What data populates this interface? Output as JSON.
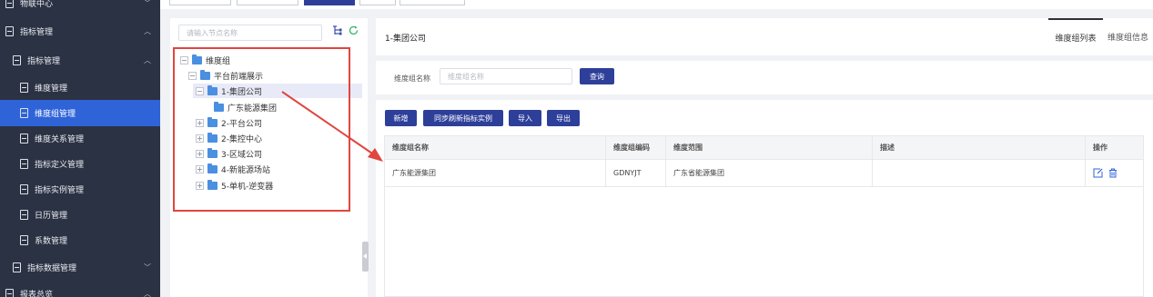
{
  "sidebar": {
    "items": [
      {
        "label": "物联中心",
        "chevron": "﹀"
      },
      {
        "label": "指标管理",
        "chevron": "︿"
      },
      {
        "label": "指标管理",
        "chevron": "︿"
      },
      {
        "label": "维度管理",
        "chevron": ""
      },
      {
        "label": "维度组管理",
        "chevron": ""
      },
      {
        "label": "维度关系管理",
        "chevron": ""
      },
      {
        "label": "指标定义管理",
        "chevron": ""
      },
      {
        "label": "指标实例管理",
        "chevron": ""
      },
      {
        "label": "日历管理",
        "chevron": ""
      },
      {
        "label": "系数管理",
        "chevron": ""
      },
      {
        "label": "指标数据管理",
        "chevron": "﹀"
      },
      {
        "label": "报表总览",
        "chevron": "︿"
      }
    ]
  },
  "tree": {
    "search_placeholder": "请输入节点名称",
    "nodes": [
      {
        "label": "维度组"
      },
      {
        "label": "平台前端展示"
      },
      {
        "label": "1-集团公司"
      },
      {
        "label": "广东能源集团"
      },
      {
        "label": "2-平台公司"
      },
      {
        "label": "2-集控中心"
      },
      {
        "label": "3-区域公司"
      },
      {
        "label": "4-新能源场站"
      },
      {
        "label": "5-单机-逆变器"
      }
    ]
  },
  "header": {
    "title": "1-集团公司",
    "tabs": [
      {
        "label": "维度组列表"
      },
      {
        "label": "维度组信息"
      }
    ]
  },
  "query": {
    "label": "维度组名称",
    "placeholder": "维度组名称",
    "button": "查询"
  },
  "toolbar": {
    "add": "新增",
    "sync": "同步刷新指标实例",
    "import": "导入",
    "export": "导出"
  },
  "table": {
    "columns": [
      "维度组名称",
      "维度组编码",
      "维度范围",
      "描述",
      "操作"
    ],
    "rows": [
      {
        "name": "广东能源集团",
        "code": "GDNYJT",
        "scope": "广东省能源集团",
        "desc": ""
      }
    ]
  },
  "colors": {
    "sidebar_bg": "#2b3243",
    "active_blue": "#2f63d8",
    "primary_button": "#2e3f9a",
    "annotation_red": "#e0463f"
  }
}
